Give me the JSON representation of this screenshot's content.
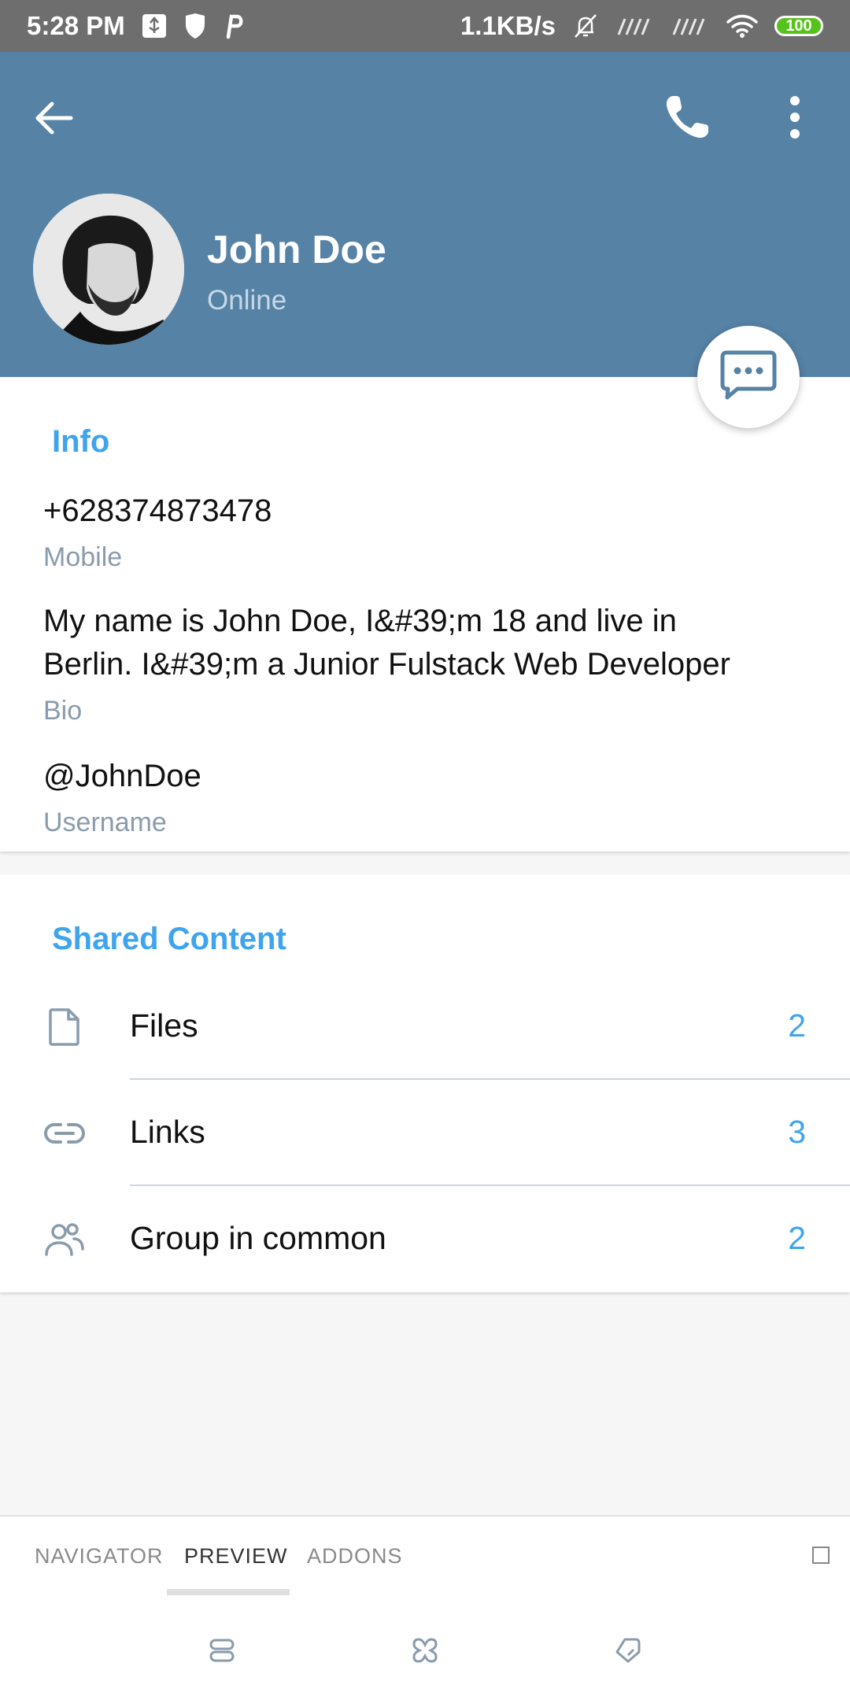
{
  "status_bar": {
    "time": "5:28 PM",
    "network_speed": "1.1KB/s",
    "battery": "100"
  },
  "header": {
    "back_icon": "arrow-left-icon",
    "call_icon": "phone-icon",
    "menu_icon": "more-vertical-icon",
    "name": "John Doe",
    "status": "Online",
    "background_color": "#5682a6"
  },
  "fab": {
    "icon": "message-icon"
  },
  "info": {
    "title": "Info",
    "phone": "+628374873478",
    "phone_label": "Mobile",
    "bio_line1": "My name is John Doe, I&#39;m 18 and live in",
    "bio_line2": "Berlin. I&#39;m a Junior Fulstack Web Developer",
    "bio_label": "Bio",
    "username": "@JohnDoe",
    "username_label": "Username"
  },
  "shared": {
    "title": "Shared Content",
    "items": [
      {
        "icon": "file-icon",
        "label": "Files",
        "count": "2"
      },
      {
        "icon": "link-icon",
        "label": "Links",
        "count": "3"
      },
      {
        "icon": "users-icon",
        "label": "Group in common",
        "count": "2"
      }
    ]
  },
  "tabs": {
    "items": [
      "NAVIGATOR",
      "PREVIEW",
      "ADDONS"
    ],
    "active": "PREVIEW"
  },
  "colors": {
    "accent": "#3fa4ee",
    "label_gray": "#8a9bac"
  }
}
